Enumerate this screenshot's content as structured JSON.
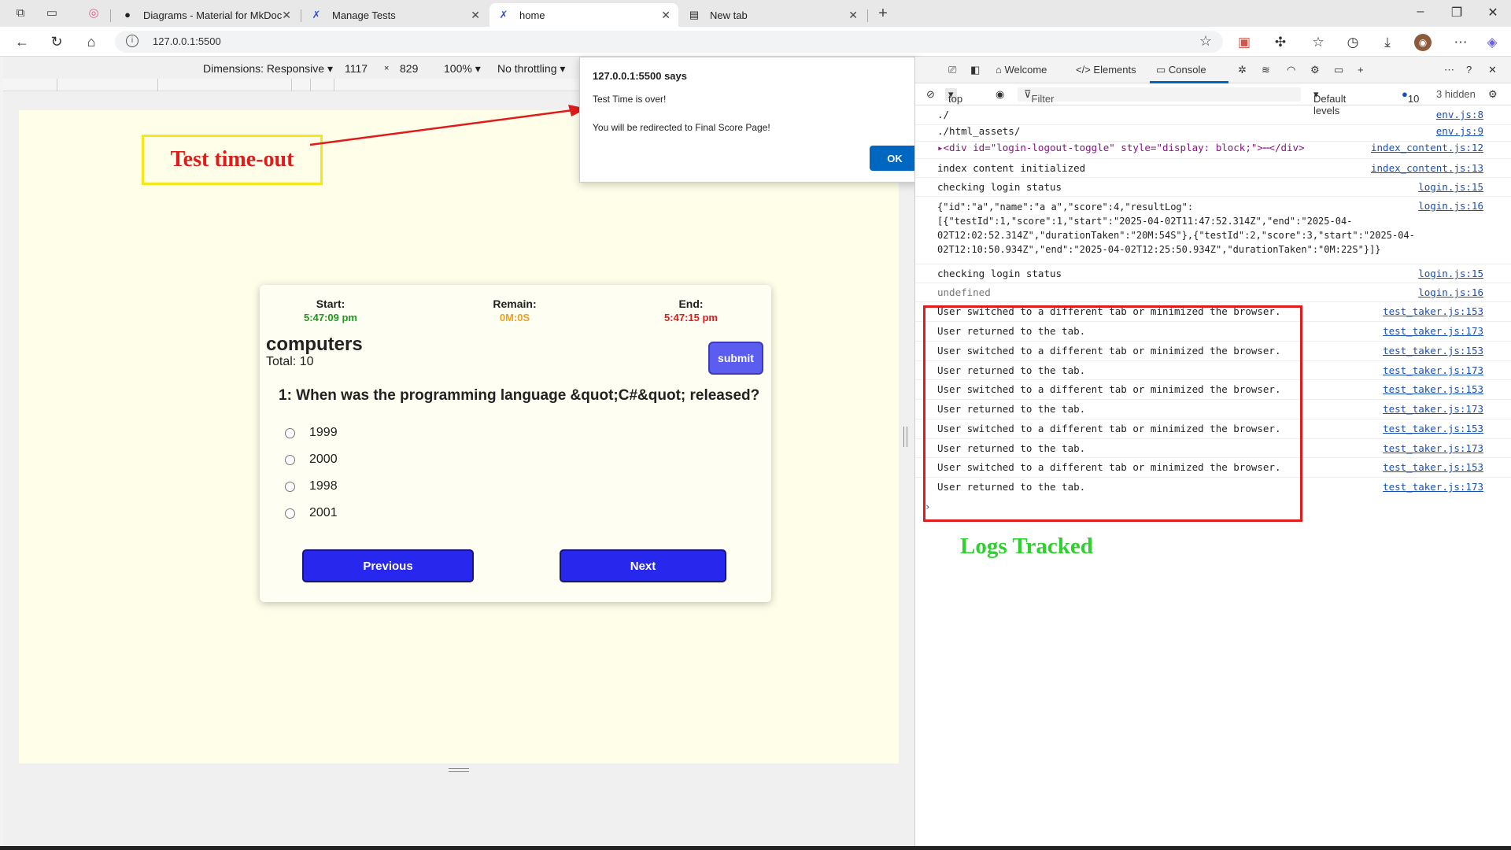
{
  "browser": {
    "tabs": [
      {
        "title": "Diagrams - Material for MkDocs",
        "active": false
      },
      {
        "title": "Manage Tests",
        "active": false
      },
      {
        "title": "home",
        "active": true
      },
      {
        "title": "New tab",
        "active": false
      }
    ],
    "url": "127.0.0.1:5500"
  },
  "device_toolbar": {
    "dimensions_label": "Dimensions: Responsive",
    "width": "1117",
    "times": "×",
    "height": "829",
    "zoom": "100%",
    "throttling": "No throttling"
  },
  "annotation": {
    "timeout_label": "Test time-out",
    "logs_label": "Logs Tracked",
    "colors": {
      "box_border": "#f5e71a",
      "text": "#e01b1b",
      "logs_border": "#e01b1b",
      "logs_text": "#2fd12f"
    }
  },
  "quiz": {
    "start_label": "Start:",
    "start_time": "5:47:09 pm",
    "remain_label": "Remain:",
    "remain_time": "0M:0S",
    "end_label": "End:",
    "end_time": "5:47:15 pm",
    "subject": "computers",
    "total": "Total: 10",
    "submit_label": "submit",
    "question": "1: When was the programming language &quot;C#&quot; released?",
    "options": [
      "1999",
      "2000",
      "1998",
      "2001"
    ],
    "previous_label": "Previous",
    "next_label": "Next",
    "colors": {
      "start": "#1e9a1e",
      "remain": "#f0a020",
      "end": "#e01b1b",
      "button": "#2727ee",
      "submit": "#5b5cf0"
    }
  },
  "dialog": {
    "title": "127.0.0.1:5500 says",
    "message1": "Test Time is over!",
    "message2": "You will be redirected to Final Score Page!",
    "ok_label": "OK"
  },
  "devtools": {
    "tabs": [
      "Welcome",
      "Elements",
      "Console"
    ],
    "context": "top",
    "filter_placeholder": "Filter",
    "levels": "Default levels",
    "issues_count": "10",
    "hidden": "3 hidden",
    "logs": [
      {
        "msg": "./",
        "src": "env.js:8"
      },
      {
        "msg": "./html_assets/",
        "src": "env.js:9"
      },
      {
        "msg": "▸<div id=\"login-logout-toggle\" style=\"display: block;\">⋯</div>",
        "src": "index_content.js:12"
      },
      {
        "msg": "index content initialized",
        "src": "index_content.js:13"
      },
      {
        "msg": "checking login status",
        "src": "login.js:15"
      },
      {
        "msg": "{\"id\":\"a\",\"name\":\"a a\",\"score\":4,\"resultLog\":\n[{\"testId\":1,\"score\":1,\"start\":\"2025-04-02T11:47:52.314Z\",\"end\":\"2025-04-\n02T12:02:52.314Z\",\"durationTaken\":\"20M:54S\"},{\"testId\":2,\"score\":3,\"start\":\"2025-04-\n02T12:10:50.934Z\",\"end\":\"2025-04-02T12:25:50.934Z\",\"durationTaken\":\"0M:22S\"}]}",
        "src": "login.js:16"
      },
      {
        "msg": "checking login status",
        "src": "login.js:15"
      },
      {
        "msg": "undefined",
        "src": "login.js:16"
      },
      {
        "msg": "User switched to a different tab or minimized the browser.",
        "src": "test_taker.js:153"
      },
      {
        "msg": "User returned to the tab.",
        "src": "test_taker.js:173"
      },
      {
        "msg": "User switched to a different tab or minimized the browser.",
        "src": "test_taker.js:153"
      },
      {
        "msg": "User returned to the tab.",
        "src": "test_taker.js:173"
      },
      {
        "msg": "User switched to a different tab or minimized the browser.",
        "src": "test_taker.js:153"
      },
      {
        "msg": "User returned to the tab.",
        "src": "test_taker.js:173"
      },
      {
        "msg": "User switched to a different tab or minimized the browser.",
        "src": "test_taker.js:153"
      },
      {
        "msg": "User returned to the tab.",
        "src": "test_taker.js:173"
      },
      {
        "msg": "User switched to a different tab or minimized the browser.",
        "src": "test_taker.js:153"
      },
      {
        "msg": "User returned to the tab.",
        "src": "test_taker.js:173"
      }
    ]
  }
}
